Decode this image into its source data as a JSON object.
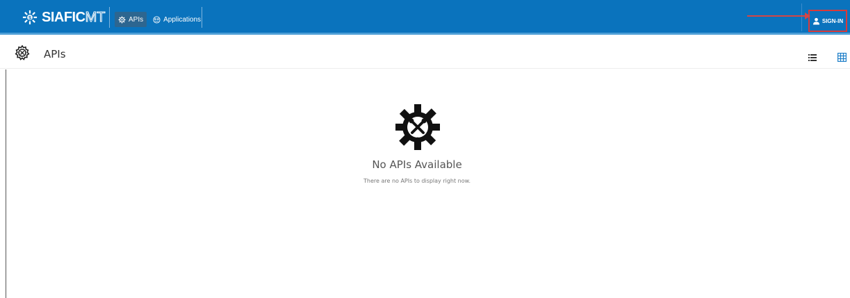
{
  "header": {
    "brand_main": "SIAFIC",
    "brand_suffix": "MT",
    "nav": [
      {
        "label": "APIs",
        "icon": "gear-icon",
        "active": true
      },
      {
        "label": "Applications",
        "icon": "applications-icon",
        "active": false
      }
    ],
    "signin_label": "SIGN-IN"
  },
  "subheader": {
    "title": "APIs",
    "icon": "api-gear-icon",
    "view_icons": [
      "list-view-icon",
      "grid-view-icon"
    ]
  },
  "empty_state": {
    "icon": "tools-gear-icon",
    "title": "No APIs Available",
    "message": "There are no APIs to display right now."
  },
  "colors": {
    "topbar": "#0a73bd",
    "highlight": "#d93a3a",
    "accent": "#1f7fc8"
  }
}
